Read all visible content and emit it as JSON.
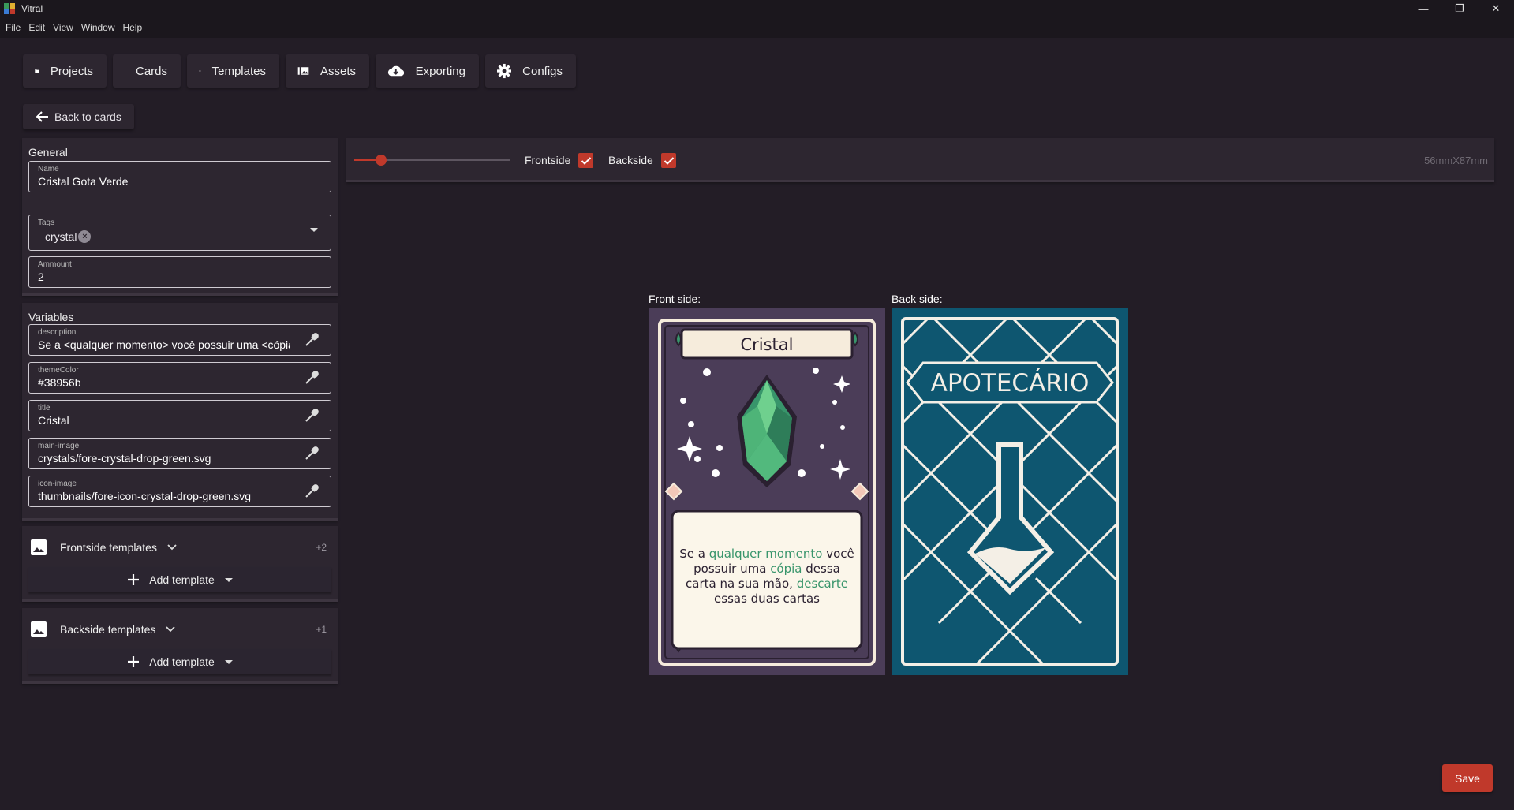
{
  "window": {
    "title": "Vitral",
    "minimize": "—",
    "maximize": "❐",
    "close": "✕",
    "icon_colors": [
      "#3a9a5b",
      "#e0b030",
      "#3a7bd5",
      "#c0392b"
    ]
  },
  "menu": [
    "File",
    "Edit",
    "View",
    "Window",
    "Help"
  ],
  "nav": {
    "projects": "Projects",
    "cards": "Cards",
    "templates": "Templates",
    "assets": "Assets",
    "exporting": "Exporting",
    "configs": "Configs"
  },
  "back_label": "Back to cards",
  "general": {
    "heading": "General",
    "name_label": "Name",
    "name_value": "Cristal Gota Verde",
    "tags_label": "Tags",
    "tags": [
      "crystal"
    ],
    "ammount_label": "Ammount",
    "ammount_value": "2"
  },
  "variables": {
    "heading": "Variables",
    "items": [
      {
        "label": "description",
        "value": "Se a <qualquer momento> você possuir uma <cópia> dessa carta na sua mão, <descarte> essas duas cartas"
      },
      {
        "label": "themeColor",
        "value": "#38956b"
      },
      {
        "label": "title",
        "value": "Cristal"
      },
      {
        "label": "main-image",
        "value": "crystals/fore-crystal-drop-green.svg"
      },
      {
        "label": "icon-image",
        "value": "thumbnails/fore-icon-crystal-drop-green.svg"
      }
    ]
  },
  "frontside_templates": {
    "label": "Frontside templates",
    "count": "+2",
    "add_label": "Add template"
  },
  "backside_templates": {
    "label": "Backside templates",
    "count": "+1",
    "add_label": "Add template"
  },
  "toolbar": {
    "zoom": 0.17,
    "frontside_label": "Frontside",
    "frontside_checked": true,
    "backside_label": "Backside",
    "backside_checked": true,
    "size": "56mmX87mm"
  },
  "preview": {
    "front_label": "Front side:",
    "back_label": "Back side:",
    "front_title": "Cristal",
    "front_text_lines": [
      [
        {
          "t": "Se a ",
          "h": false
        },
        {
          "t": "qualquer momento",
          "h": true
        },
        {
          "t": " você",
          "h": false
        }
      ],
      [
        {
          "t": "possuir uma ",
          "h": false
        },
        {
          "t": "cópia",
          "h": true
        },
        {
          "t": " dessa",
          "h": false
        }
      ],
      [
        {
          "t": "carta na sua mão, ",
          "h": false
        },
        {
          "t": "descarte",
          "h": true
        }
      ],
      [
        {
          "t": "essas duas cartas",
          "h": false
        }
      ]
    ],
    "back_title": "APOTECÁRIO",
    "front_bg": "#4b3d58",
    "theme_color": "#38956b",
    "back_bg": "#0e5670"
  },
  "save_label": "Save",
  "accent": "#c0392b"
}
